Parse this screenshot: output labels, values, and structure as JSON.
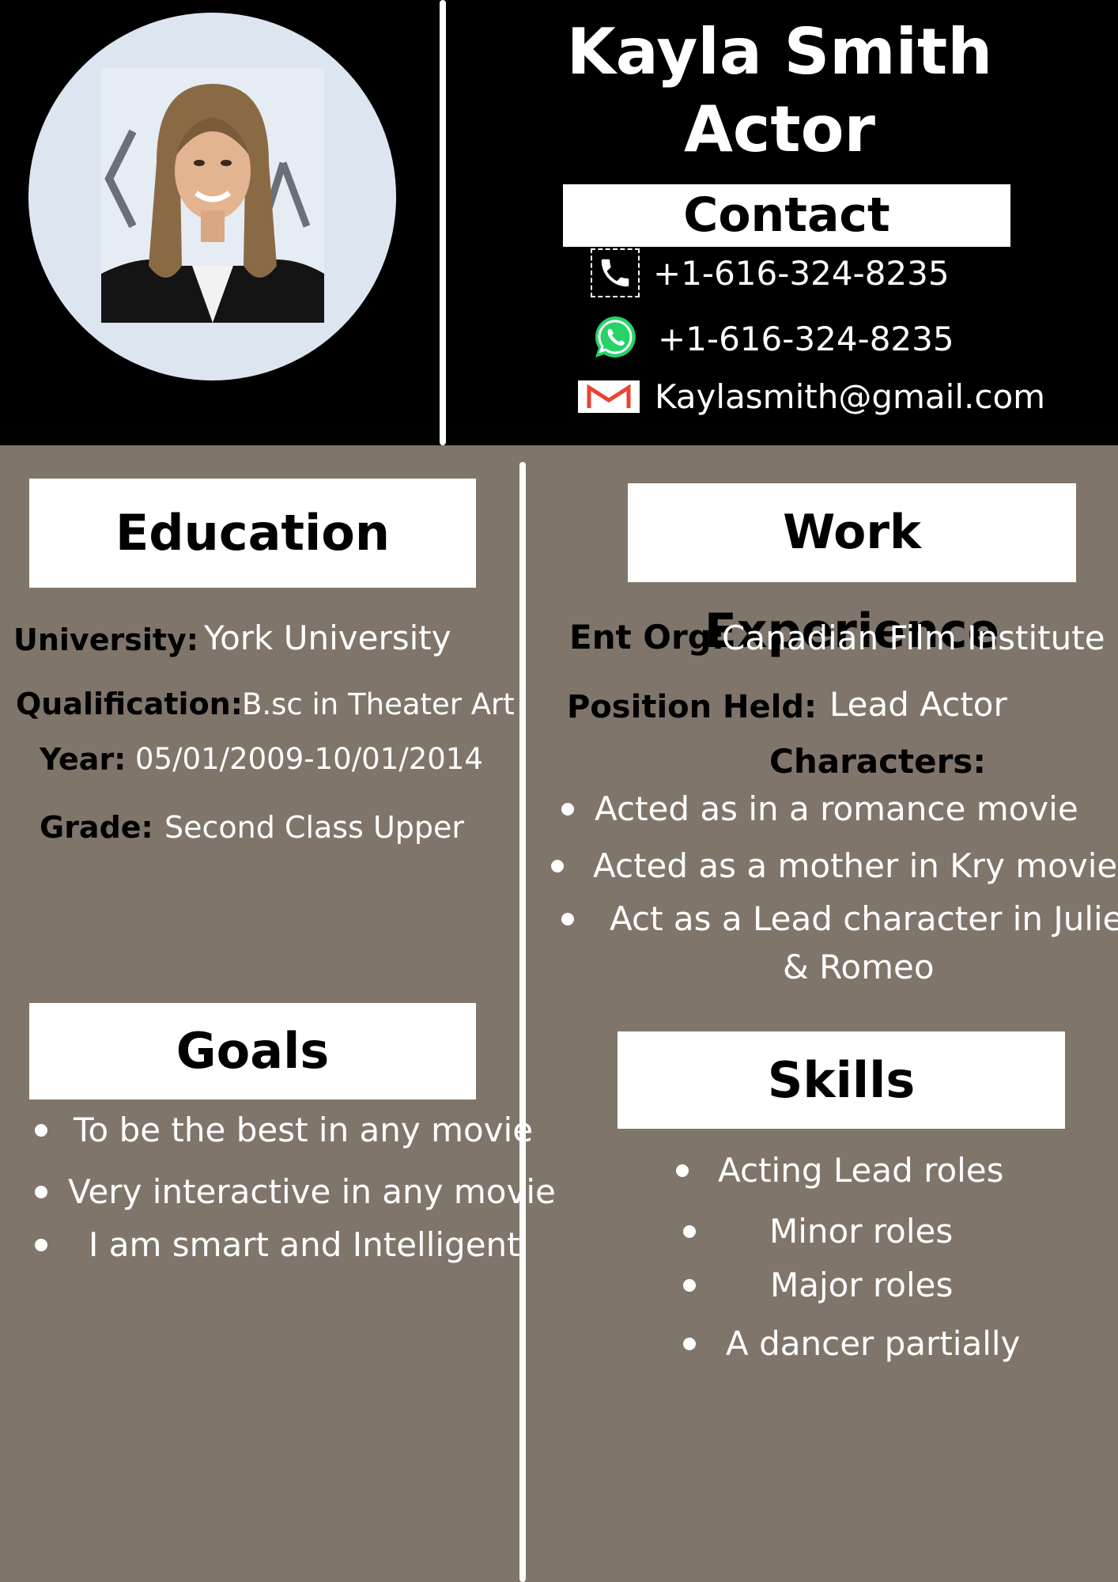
{
  "header": {
    "name": "Kayla Smith",
    "role": "Actor"
  },
  "contact": {
    "title": "Contact",
    "phone": "+1-616-324-8235",
    "whatsapp": "+1-616-324-8235",
    "email": "Kaylasmith@gmail.com"
  },
  "education": {
    "title": "Education",
    "university_label": "University:",
    "university": "York University",
    "qualification_label": "Qualification:",
    "qualification": "B.sc in Theater Art",
    "year_label": "Year:",
    "year": "05/01/2009-10/01/2014",
    "grade_label": "Grade:",
    "grade": "Second Class Upper"
  },
  "work": {
    "title": "Work Experience",
    "org_label": "Ent Org:",
    "org": "Canadian Film Institute",
    "position_label": "Position Held:",
    "position": "Lead Actor",
    "characters_label": "Characters:",
    "characters": [
      "Acted as in a romance movie",
      "Acted as a mother in Kry movie",
      "Act as a Lead character in Juliet",
      "& Romeo"
    ]
  },
  "goals": {
    "title": "Goals",
    "items": [
      "To be the best in any movie",
      "Very interactive in any movie",
      "I am smart and Intelligent"
    ]
  },
  "skills": {
    "title": "Skills",
    "items": [
      "Acting Lead roles",
      "Minor roles",
      "Major roles",
      "A dancer partially"
    ]
  },
  "colors": {
    "header_bg": "#000000",
    "body_bg": "#7f756b",
    "box_bg": "#ffffff",
    "whatsapp_green": "#25d366",
    "gmail_red": "#ea4335"
  },
  "icons": [
    "phone-icon",
    "whatsapp-icon",
    "gmail-icon"
  ]
}
